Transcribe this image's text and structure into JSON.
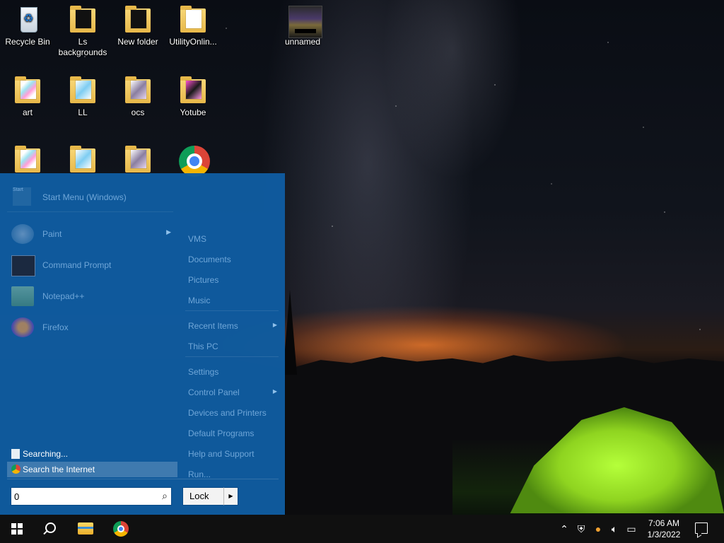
{
  "desktop": {
    "icons_row1": [
      {
        "label": "Recycle Bin"
      },
      {
        "label": "Ls backgrounds"
      },
      {
        "label": "New folder"
      },
      {
        "label": "UtilityOnlin..."
      },
      {
        "label": "unnamed"
      }
    ],
    "icons_row2": [
      {
        "label": "art"
      },
      {
        "label": "LL"
      },
      {
        "label": "ocs"
      },
      {
        "label": "Yotube"
      }
    ]
  },
  "start_menu": {
    "header_title": "Start Menu (Windows)",
    "header_logo_text": "Start",
    "pinned": [
      {
        "label": "Paint",
        "has_submenu": true
      },
      {
        "label": "Command Prompt"
      },
      {
        "label": "Notepad++"
      },
      {
        "label": "Firefox"
      }
    ],
    "right_column": {
      "group1": [
        "VMS",
        "Documents",
        "Pictures",
        "Music"
      ],
      "group2": [
        {
          "label": "Recent Items",
          "has_submenu": true
        },
        {
          "label": "This PC"
        }
      ],
      "group3": [
        {
          "label": "Settings"
        },
        {
          "label": "Control Panel",
          "has_submenu": true
        },
        {
          "label": "Devices and Printers"
        },
        {
          "label": "Default Programs"
        },
        {
          "label": "Help and Support"
        },
        {
          "label": "Run..."
        }
      ]
    },
    "search_results": [
      {
        "label": "Searching...",
        "icon": "document-icon"
      },
      {
        "label": "Search the Internet",
        "icon": "chrome-icon"
      }
    ],
    "search_input_value": "0",
    "lock_label": "Lock"
  },
  "taskbar": {
    "clock_time": "7:06 AM",
    "clock_date": "1/3/2022",
    "pinned_apps": [
      "file-explorer-icon",
      "chrome-icon"
    ]
  },
  "colors": {
    "start_menu_bg": "#105ca0",
    "taskbar_bg": "#101010",
    "menu_text_dim": "#6fa6d8"
  }
}
